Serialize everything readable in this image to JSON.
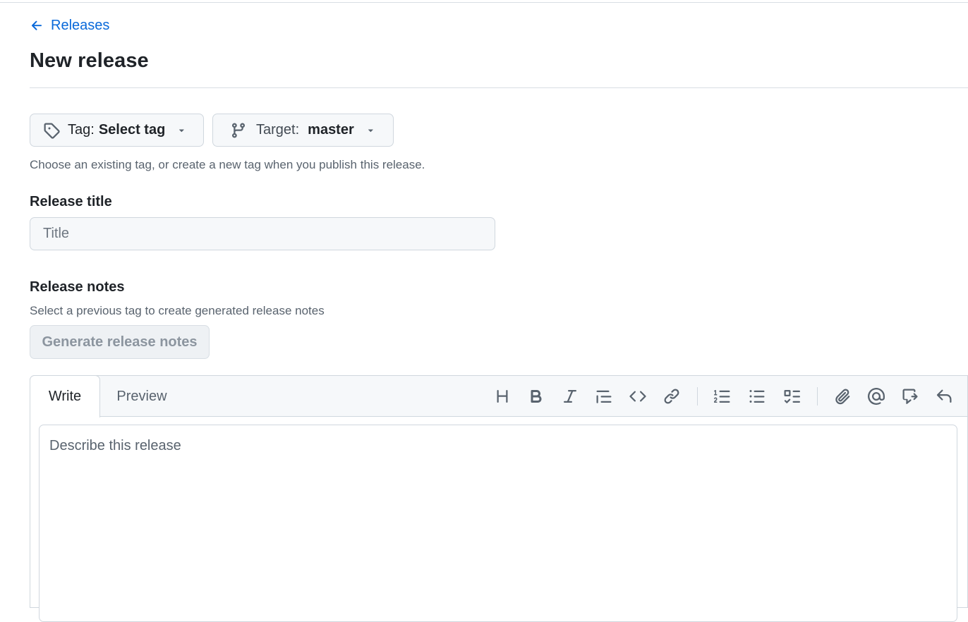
{
  "nav": {
    "back_label": "Releases",
    "back_icon": "arrow-left-icon"
  },
  "page": {
    "title": "New release"
  },
  "tag_picker": {
    "prefix": "Tag:",
    "value": "Select tag",
    "icon": "tag-icon"
  },
  "target_picker": {
    "prefix": "Target:",
    "value": "master",
    "icon": "git-branch-icon"
  },
  "tag_hint": "Choose an existing tag, or create a new tag when you publish this release.",
  "release_title": {
    "label": "Release title",
    "placeholder": "Title",
    "value": ""
  },
  "release_notes": {
    "label": "Release notes",
    "hint": "Select a previous tag to create generated release notes",
    "generate_label": "Generate release notes",
    "generate_enabled": false
  },
  "editor": {
    "tabs": [
      {
        "label": "Write",
        "active": true
      },
      {
        "label": "Preview",
        "active": false
      }
    ],
    "toolbar": [
      {
        "name": "heading-icon",
        "tooltip": "Heading"
      },
      {
        "name": "bold-icon",
        "tooltip": "Bold"
      },
      {
        "name": "italic-icon",
        "tooltip": "Italic"
      },
      {
        "name": "quote-icon",
        "tooltip": "Quote"
      },
      {
        "name": "code-icon",
        "tooltip": "Code"
      },
      {
        "name": "link-icon",
        "tooltip": "Link"
      },
      {
        "name": "numbered-list-icon",
        "tooltip": "Numbered list"
      },
      {
        "name": "unordered-list-icon",
        "tooltip": "Unordered list"
      },
      {
        "name": "task-list-icon",
        "tooltip": "Task list"
      },
      {
        "name": "attach-icon",
        "tooltip": "Attach files"
      },
      {
        "name": "mention-icon",
        "tooltip": "Mention"
      },
      {
        "name": "cross-reference-icon",
        "tooltip": "Reference"
      },
      {
        "name": "reply-icon",
        "tooltip": "Saved replies"
      }
    ],
    "placeholder": "Describe this release"
  },
  "colors": {
    "link": "#0969da",
    "text": "#1f2328",
    "muted": "#59636e",
    "border": "#d0d7de",
    "field_bg": "#f6f8fa"
  }
}
